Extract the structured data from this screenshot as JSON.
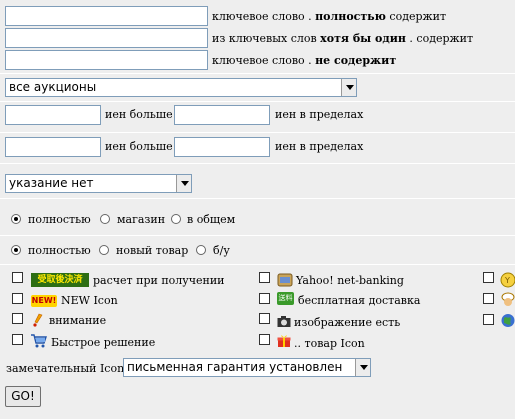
{
  "keyword_rows": [
    {
      "value": "",
      "prefix": "ключевое слово . ",
      "bold": "полностью",
      "suffix": " содержит"
    },
    {
      "value": "",
      "prefix": "из ключевых слов ",
      "bold": "хотя бы один",
      "suffix": " . содержит"
    },
    {
      "value": "",
      "prefix": "ключевое слово . ",
      "bold": "не содержит",
      "suffix": ""
    }
  ],
  "auction_select": {
    "selected": "все аукционы"
  },
  "price_rows": [
    {
      "min_value": "",
      "label_more": "иен больше",
      "max_value": "",
      "label_within": "иен в пределах"
    },
    {
      "min_value": "",
      "label_more": "иен больше",
      "max_value": "",
      "label_within": "иен в пределах"
    }
  ],
  "spec_select": {
    "selected": "указание нет"
  },
  "seller_radios": {
    "options": [
      "полностью",
      "магазин",
      "в общем"
    ],
    "selected_index": 0
  },
  "condition_radios": {
    "options": [
      "полностью",
      "новый товар",
      "б/у"
    ],
    "selected_index": 0
  },
  "options": {
    "col1": [
      {
        "icon": "payment-after-receipt-icon",
        "icon_text": "受取後決済",
        "label": "расчет при получении"
      },
      {
        "icon": "new-icon",
        "icon_text": "NEW!",
        "label": "NEW Icon"
      },
      {
        "icon": "attention-icon",
        "label": "внимание"
      },
      {
        "icon": "shopping-cart-icon",
        "label": "Быстрое решение"
      }
    ],
    "col2": [
      {
        "icon": "yahoo-wallet-icon",
        "label": "Yahoo! net-banking"
      },
      {
        "icon": "free-shipping-truck-icon",
        "icon_text": "送料",
        "label": "бесплатная доставка"
      },
      {
        "icon": "camera-icon",
        "label": "изображение есть"
      },
      {
        "icon": "gift-icon",
        "label": ".. товар Icon"
      }
    ],
    "col3": [
      {
        "icon": "yahoo-coin-icon"
      },
      {
        "icon": "chef-icon"
      },
      {
        "icon": "globe-icon"
      }
    ]
  },
  "notable_icon": {
    "label": "замечательный Icon",
    "selected": "письменная гарантия установлен"
  },
  "go_button": {
    "label": "GO!"
  },
  "colors": {
    "band": "#eeeeee",
    "input_border": "#7f9db9"
  }
}
